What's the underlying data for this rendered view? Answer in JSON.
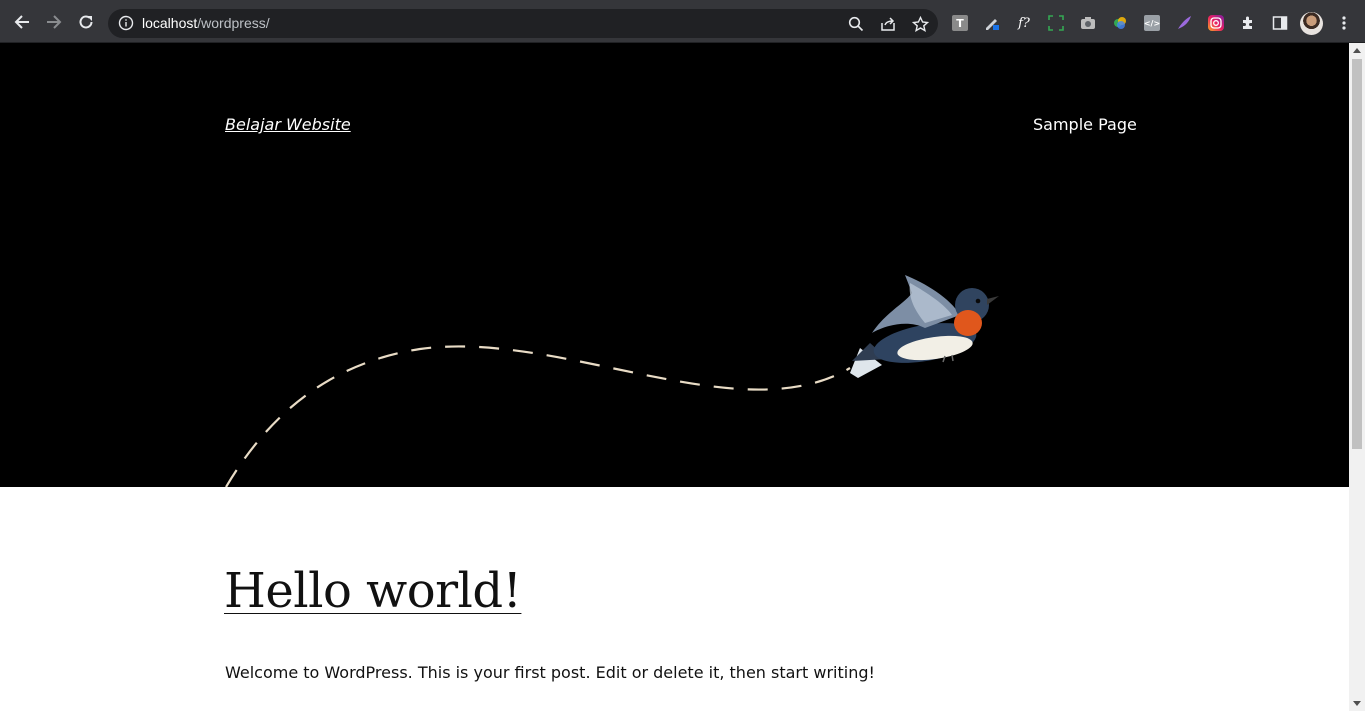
{
  "browser": {
    "url_host": "localhost",
    "url_path": "/wordpress/",
    "nav_icons": [
      "back-arrow-icon",
      "forward-arrow-icon",
      "reload-icon"
    ],
    "omnibox_icons": [
      "site-info-icon",
      "zoom-icon",
      "share-icon",
      "bookmark-star-icon"
    ],
    "extension_icons": [
      "text-extension-icon",
      "pen-extension-icon",
      "font-extension-icon",
      "screenshot-area-icon",
      "camera-icon",
      "color-picker-icon",
      "code-extension-icon",
      "feather-icon",
      "instagram-icon",
      "puzzle-icon",
      "side-panel-icon"
    ],
    "menu_icon": "kebab-menu-icon"
  },
  "site": {
    "title": "Belajar Website",
    "nav": [
      "Sample Page"
    ],
    "hero_background": "#000000"
  },
  "post": {
    "title": "Hello world!",
    "content": "Welcome to WordPress. This is your first post. Edit or delete it, then start writing!"
  }
}
